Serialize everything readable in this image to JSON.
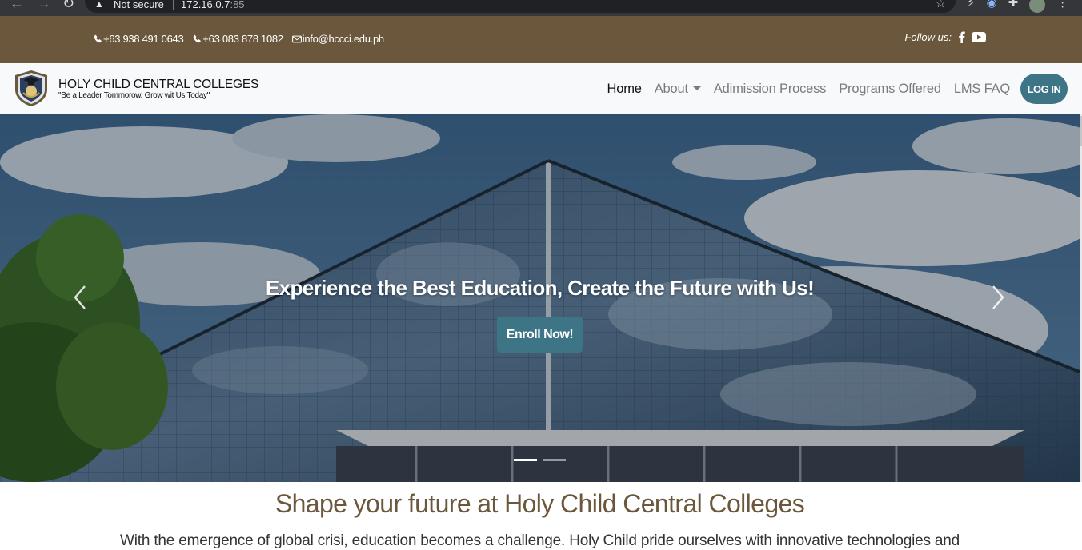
{
  "browser": {
    "security_label": "Not secure",
    "url_host": "172.16.0.7",
    "url_port": ":85"
  },
  "topbar": {
    "phone1": "+63 938 491 0643",
    "phone2": "+63 083 878 1082",
    "email": "info@hccci.edu.ph",
    "follow_label": "Follow us:",
    "bg_color": "#6b573c"
  },
  "brand": {
    "name": "HOLY CHILD CENTRAL COLLEGES",
    "tagline": "\"Be a Leader Tommorow, Grow wit Us Today\""
  },
  "nav": {
    "items": [
      {
        "label": "Home",
        "active": true
      },
      {
        "label": "About",
        "dropdown": true
      },
      {
        "label": "Adimission Process"
      },
      {
        "label": "Programs Offered"
      },
      {
        "label": "LMS FAQ"
      }
    ],
    "login_label": "LOG IN",
    "accent_color": "#3d7486"
  },
  "hero": {
    "title": "Experience the Best Education, Create the Future with Us!",
    "cta_label": "Enroll Now!",
    "slides_count": 2,
    "active_slide": 1
  },
  "section": {
    "title": "Shape your future at Holy Child Central Colleges",
    "text": "With the emergence of global crisi, education becomes a challenge. Holy Child pride ourselves with innovative technologies and"
  }
}
